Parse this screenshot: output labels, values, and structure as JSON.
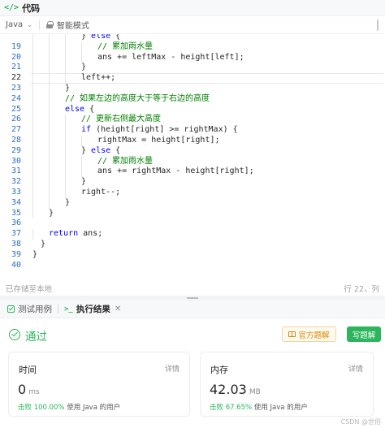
{
  "header": {
    "icon": "code-brackets-icon",
    "icon_glyph": "</>",
    "title": "代码"
  },
  "toolbar": {
    "language": "Java",
    "mode": "智能模式"
  },
  "editor": {
    "active_line": 22,
    "lines": [
      {
        "num": "",
        "code": "} else {",
        "indent": 3,
        "tokens": [
          {
            "t": "} ",
            "c": ""
          },
          {
            "t": "else",
            "c": "kw"
          },
          {
            "t": " {",
            "c": ""
          }
        ]
      },
      {
        "num": "19",
        "indent": 4,
        "tokens": [
          {
            "t": "// 累加雨水量",
            "c": "cm"
          }
        ]
      },
      {
        "num": "20",
        "indent": 4,
        "tokens": [
          {
            "t": "ans += leftMax - height[left];",
            "c": ""
          }
        ]
      },
      {
        "num": "21",
        "indent": 3,
        "tokens": [
          {
            "t": "}",
            "c": ""
          }
        ]
      },
      {
        "num": "22",
        "indent": 3,
        "tokens": [
          {
            "t": "left++;",
            "c": ""
          }
        ]
      },
      {
        "num": "23",
        "indent": 2,
        "tokens": [
          {
            "t": "}",
            "c": ""
          }
        ]
      },
      {
        "num": "24",
        "indent": 2,
        "tokens": [
          {
            "t": "// 如果左边的高度大于等于右边的高度",
            "c": "cm"
          }
        ]
      },
      {
        "num": "25",
        "indent": 2,
        "tokens": [
          {
            "t": "else",
            "c": "kw"
          },
          {
            "t": " {",
            "c": ""
          }
        ]
      },
      {
        "num": "26",
        "indent": 3,
        "tokens": [
          {
            "t": "// 更新右侧最大高度",
            "c": "cm"
          }
        ]
      },
      {
        "num": "27",
        "indent": 3,
        "tokens": [
          {
            "t": "if",
            "c": "kw"
          },
          {
            "t": " (height[right] >= rightMax) {",
            "c": ""
          }
        ]
      },
      {
        "num": "28",
        "indent": 4,
        "tokens": [
          {
            "t": "rightMax = height[right];",
            "c": ""
          }
        ]
      },
      {
        "num": "29",
        "indent": 3,
        "tokens": [
          {
            "t": "} ",
            "c": ""
          },
          {
            "t": "else",
            "c": "kw"
          },
          {
            "t": " {",
            "c": ""
          }
        ]
      },
      {
        "num": "30",
        "indent": 4,
        "tokens": [
          {
            "t": "// 累加雨水量",
            "c": "cm"
          }
        ]
      },
      {
        "num": "31",
        "indent": 4,
        "tokens": [
          {
            "t": "ans += rightMax - height[right];",
            "c": ""
          }
        ]
      },
      {
        "num": "32",
        "indent": 3,
        "tokens": [
          {
            "t": "}",
            "c": ""
          }
        ]
      },
      {
        "num": "33",
        "indent": 3,
        "tokens": [
          {
            "t": "right--;",
            "c": ""
          }
        ]
      },
      {
        "num": "34",
        "indent": 2,
        "tokens": [
          {
            "t": "}",
            "c": ""
          }
        ]
      },
      {
        "num": "35",
        "indent": 1,
        "tokens": [
          {
            "t": "}",
            "c": ""
          }
        ]
      },
      {
        "num": "36",
        "indent": 0,
        "tokens": []
      },
      {
        "num": "37",
        "indent": 1,
        "tokens": [
          {
            "t": "return",
            "c": "kw"
          },
          {
            "t": " ans;",
            "c": ""
          }
        ]
      },
      {
        "num": "38",
        "indent": 0.5,
        "tokens": [
          {
            "t": "}",
            "c": ""
          }
        ]
      },
      {
        "num": "39",
        "indent": 0,
        "tokens": [
          {
            "t": "}",
            "c": ""
          }
        ]
      },
      {
        "num": "40",
        "indent": 0,
        "tokens": []
      }
    ]
  },
  "status": {
    "saved": "已存储至本地",
    "cursor": "行 22，列"
  },
  "tabs": [
    {
      "label": "测试用例",
      "icon": "checkbox-icon",
      "active": false
    },
    {
      "label": "执行结果",
      "icon": "terminal-icon",
      "icon_glyph": ">_",
      "active": true,
      "close_glyph": "✕"
    }
  ],
  "result": {
    "status_label": "通过",
    "official_solution_label": "官方题解",
    "write_solution_label": "写题解",
    "runtime": {
      "label": "时间",
      "details_label": "详情",
      "value": "0",
      "unit": "ms",
      "beat_prefix": "击败",
      "beat_percent": "100.00%",
      "beat_suffix": "使用 Java 的用户"
    },
    "memory": {
      "label": "内存",
      "details_label": "详情",
      "value": "42.03",
      "unit": "MB",
      "beat_prefix": "击败",
      "beat_percent": "67.65%",
      "beat_suffix": "使用 Java 的用户"
    }
  },
  "watermark": "CSDN @世俗"
}
